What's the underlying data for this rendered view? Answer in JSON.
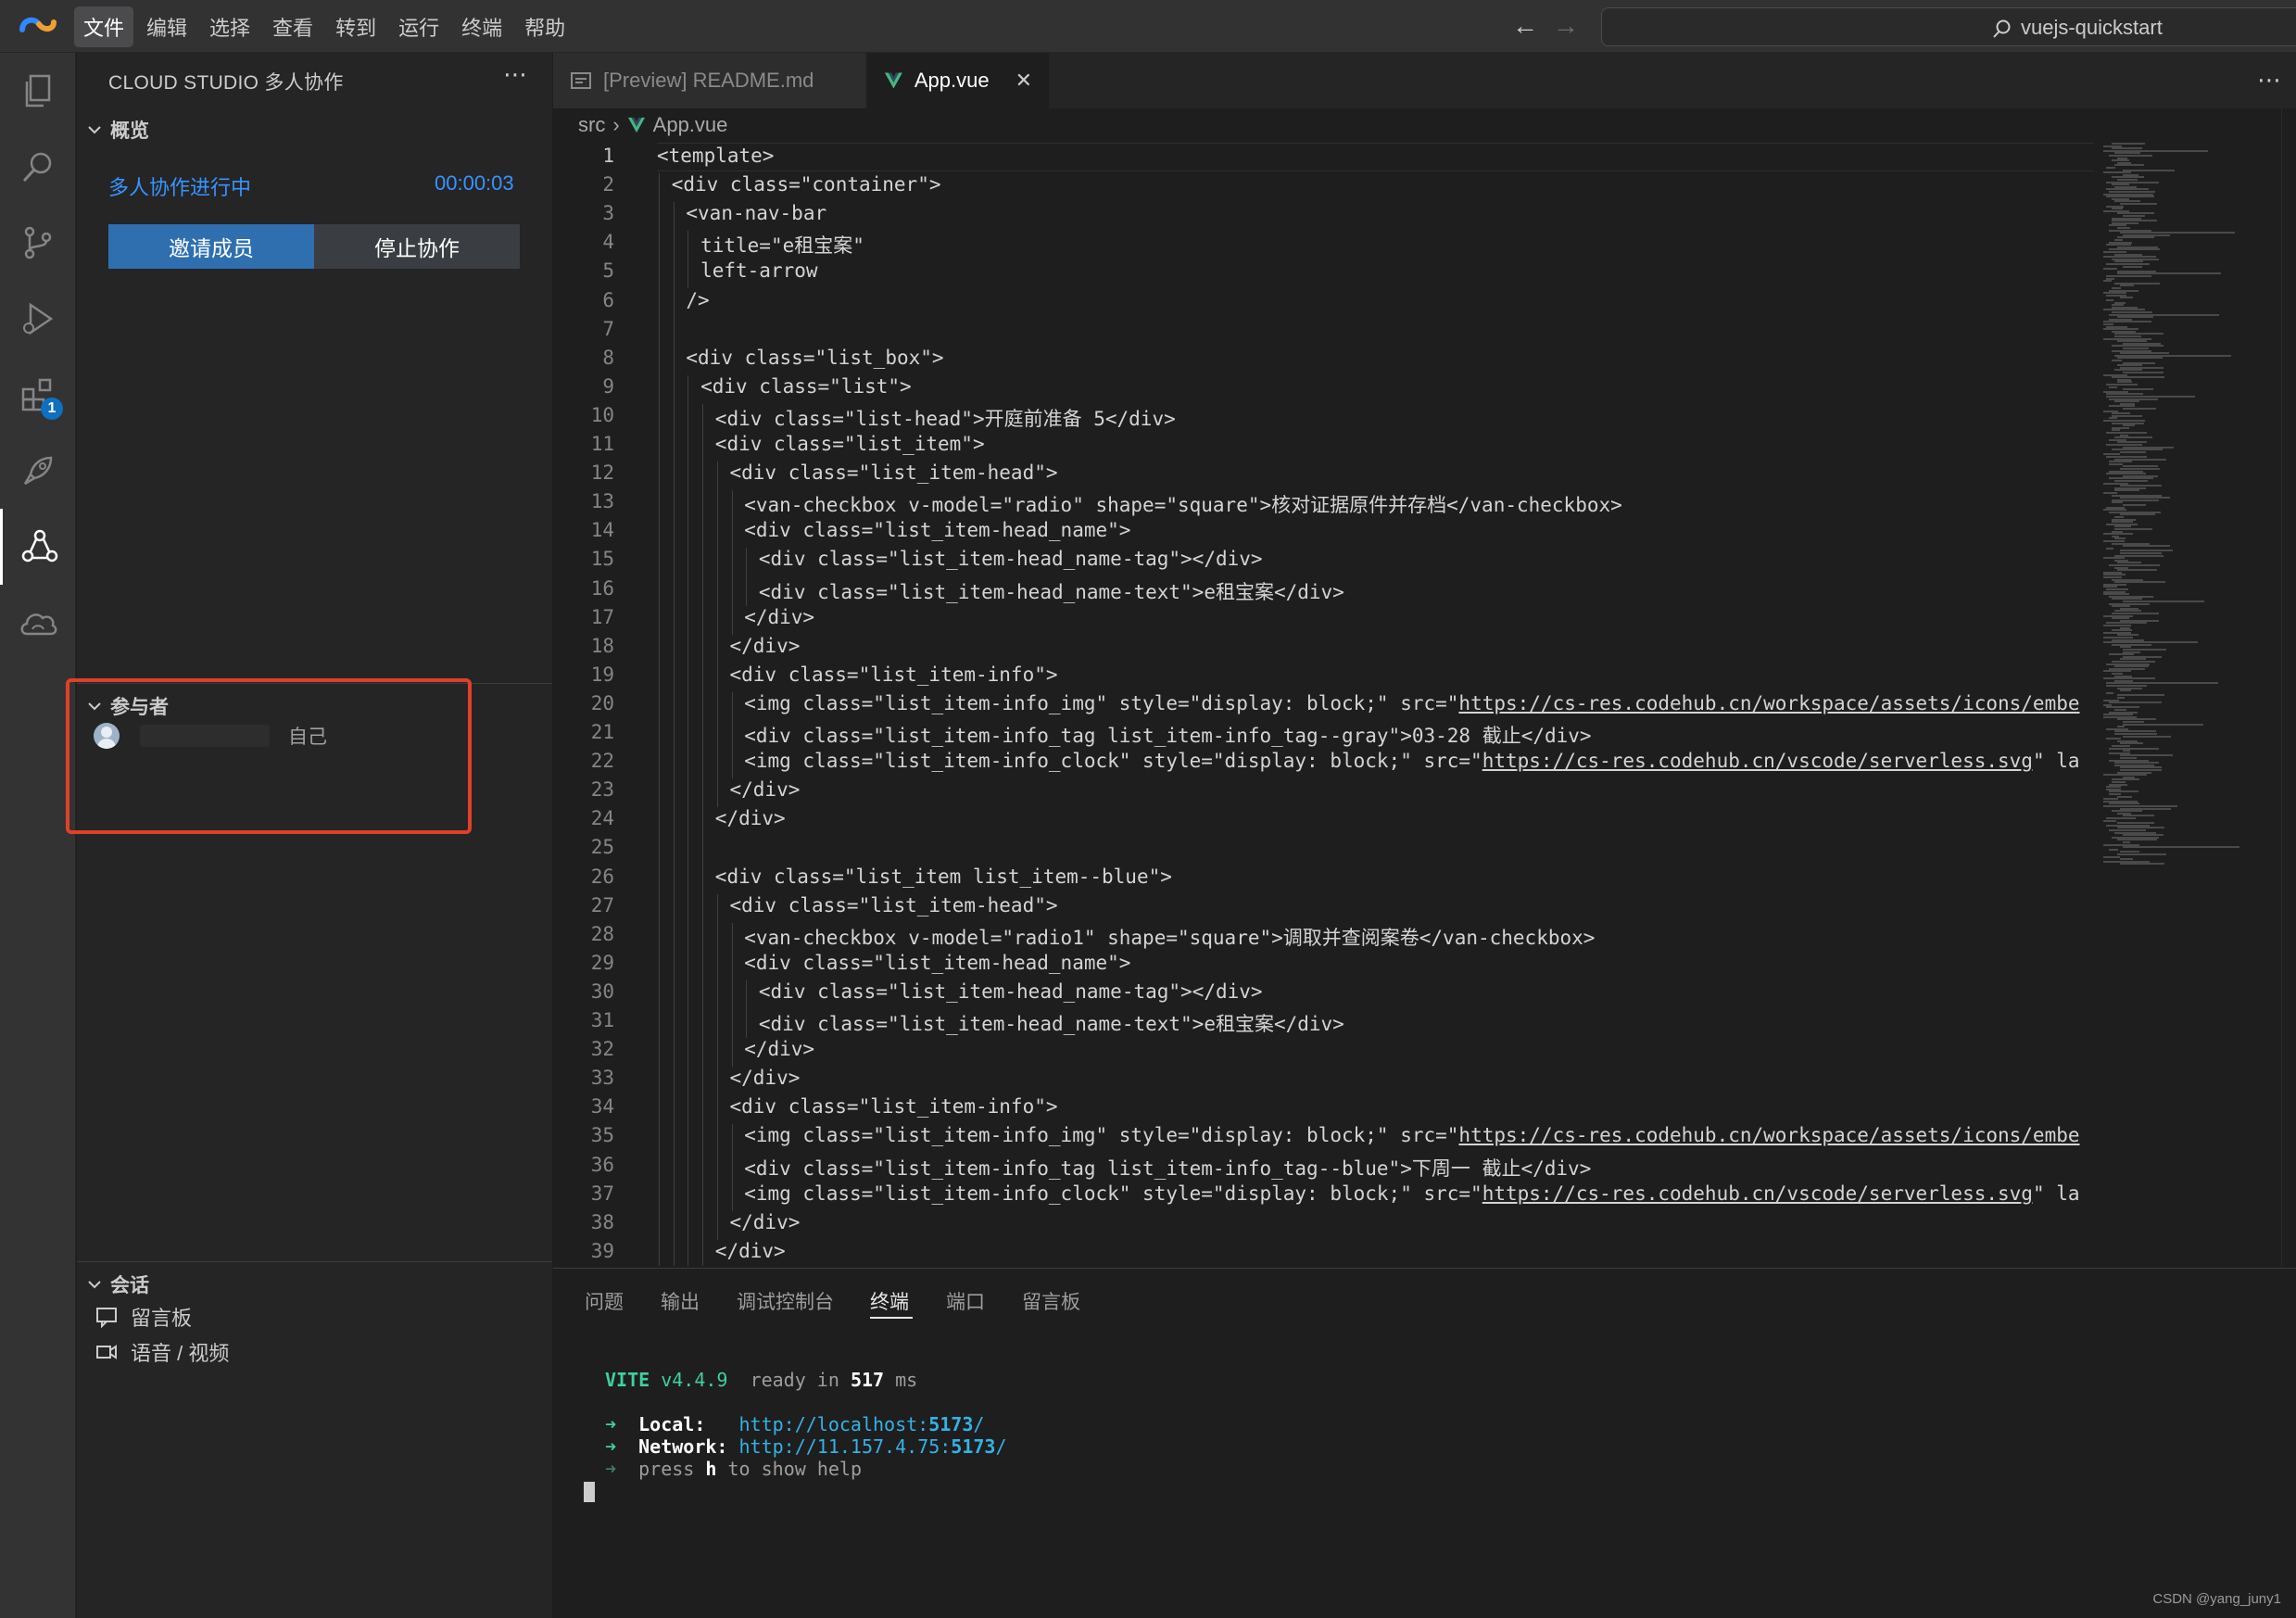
{
  "menu": {
    "items": [
      "文件",
      "编辑",
      "选择",
      "查看",
      "转到",
      "运行",
      "终端",
      "帮助"
    ],
    "active_index": 0
  },
  "search": {
    "text": "vuejs-quickstart"
  },
  "activity_bar": {
    "icons": [
      "explorer-icon",
      "search-icon",
      "source-control-icon",
      "run-debug-icon",
      "extensions-icon",
      "deploy-icon",
      "collaboration-icon",
      "cloud-icon"
    ],
    "extensions_badge": "1"
  },
  "sidebar": {
    "title": "CLOUD STUDIO 多人协作",
    "overview": {
      "heading": "概览",
      "status": "多人协作进行中",
      "timer": "00:00:03",
      "invite_label": "邀请成员",
      "stop_label": "停止协作"
    },
    "participants": {
      "heading": "参与者",
      "self_label": "自己"
    },
    "session": {
      "heading": "会话",
      "items": [
        "留言板",
        "语音 / 视频"
      ]
    }
  },
  "tabs": [
    {
      "label": "[Preview] README.md",
      "active": false
    },
    {
      "label": "App.vue",
      "active": true
    }
  ],
  "breadcrumb": [
    "src",
    "App.vue"
  ],
  "code": {
    "current_line": 1,
    "lines": [
      {
        "n": "1",
        "indent": 0,
        "text": "<template>"
      },
      {
        "n": "2",
        "indent": 1,
        "text": "<div class=\"container\">"
      },
      {
        "n": "3",
        "indent": 2,
        "text": "<van-nav-bar"
      },
      {
        "n": "4",
        "indent": 3,
        "text": "title=\"e租宝案\""
      },
      {
        "n": "5",
        "indent": 3,
        "text": "left-arrow"
      },
      {
        "n": "6",
        "indent": 2,
        "text": "/>"
      },
      {
        "n": "7",
        "indent": 0,
        "text": ""
      },
      {
        "n": "8",
        "indent": 2,
        "text": "<div class=\"list_box\">"
      },
      {
        "n": "9",
        "indent": 3,
        "text": "<div class=\"list\">"
      },
      {
        "n": "10",
        "indent": 4,
        "text": "<div class=\"list-head\">开庭前准备 5</div>"
      },
      {
        "n": "11",
        "indent": 4,
        "text": "<div class=\"list_item\">"
      },
      {
        "n": "12",
        "indent": 5,
        "text": "<div class=\"list_item-head\">"
      },
      {
        "n": "13",
        "indent": 6,
        "text": "<van-checkbox v-model=\"radio\" shape=\"square\">核对证据原件并存档</van-checkbox>"
      },
      {
        "n": "14",
        "indent": 6,
        "text": "<div class=\"list_item-head_name\">"
      },
      {
        "n": "15",
        "indent": 7,
        "text": "<div class=\"list_item-head_name-tag\"></div>"
      },
      {
        "n": "16",
        "indent": 7,
        "text": "<div class=\"list_item-head_name-text\">e租宝案</div>"
      },
      {
        "n": "17",
        "indent": 6,
        "text": "</div>"
      },
      {
        "n": "18",
        "indent": 5,
        "text": "</div>"
      },
      {
        "n": "19",
        "indent": 5,
        "text": "<div class=\"list_item-info\">"
      },
      {
        "n": "20",
        "indent": 6,
        "text": "<img class=\"list_item-info_img\" style=\"display: block;\" src=\"",
        "url": "https://cs-res.codehub.cn/workspace/assets/icons/embe"
      },
      {
        "n": "21",
        "indent": 6,
        "text": "<div class=\"list_item-info_tag list_item-info_tag--gray\">03-28 截止</div>"
      },
      {
        "n": "22",
        "indent": 6,
        "text": "<img class=\"list_item-info_clock\" style=\"display: block;\" src=\"",
        "url": "https://cs-res.codehub.cn/vscode/serverless.svg",
        "tail": "\" la"
      },
      {
        "n": "23",
        "indent": 5,
        "text": "</div>"
      },
      {
        "n": "24",
        "indent": 4,
        "text": "</div>"
      },
      {
        "n": "25",
        "indent": 0,
        "text": ""
      },
      {
        "n": "26",
        "indent": 4,
        "text": "<div class=\"list_item list_item--blue\">"
      },
      {
        "n": "27",
        "indent": 5,
        "text": "<div class=\"list_item-head\">"
      },
      {
        "n": "28",
        "indent": 6,
        "text": "<van-checkbox v-model=\"radio1\" shape=\"square\">调取并查阅案卷</van-checkbox>"
      },
      {
        "n": "29",
        "indent": 6,
        "text": "<div class=\"list_item-head_name\">"
      },
      {
        "n": "30",
        "indent": 7,
        "text": "<div class=\"list_item-head_name-tag\"></div>"
      },
      {
        "n": "31",
        "indent": 7,
        "text": "<div class=\"list_item-head_name-text\">e租宝案</div>"
      },
      {
        "n": "32",
        "indent": 6,
        "text": "</div>"
      },
      {
        "n": "33",
        "indent": 5,
        "text": "</div>"
      },
      {
        "n": "34",
        "indent": 5,
        "text": "<div class=\"list_item-info\">"
      },
      {
        "n": "35",
        "indent": 6,
        "text": "<img class=\"list_item-info_img\" style=\"display: block;\" src=\"",
        "url": "https://cs-res.codehub.cn/workspace/assets/icons/embe"
      },
      {
        "n": "36",
        "indent": 6,
        "text": "<div class=\"list_item-info_tag list_item-info_tag--blue\">下周一 截止</div>"
      },
      {
        "n": "37",
        "indent": 6,
        "text": "<img class=\"list_item-info_clock\" style=\"display: block;\" src=\"",
        "url": "https://cs-res.codehub.cn/vscode/serverless.svg",
        "tail": "\" la"
      },
      {
        "n": "38",
        "indent": 5,
        "text": "</div>"
      },
      {
        "n": "39",
        "indent": 4,
        "text": "</div>"
      }
    ]
  },
  "panel": {
    "tabs": [
      "问题",
      "输出",
      "调试控制台",
      "终端",
      "端口",
      "留言板"
    ],
    "active_tab": "终端",
    "terminal": {
      "vite_name": "VITE",
      "vite_version": "v4.4.9",
      "ready_text": "ready in",
      "ready_ms": "517",
      "ms_unit": "ms",
      "arrow": "➜",
      "local_label": "Local:",
      "local_url_prefix": "http://localhost:",
      "local_port": "5173",
      "network_label": "Network:",
      "network_url_prefix": "http://11.157.4.75:",
      "network_port": "5173",
      "help_press": "press",
      "help_key": "h",
      "help_rest": "to show help"
    }
  },
  "watermark": "CSDN @yang_juny1",
  "colors": {
    "accent_blue": "#3794ff",
    "primary_button": "#2f6fb0",
    "highlight_red": "#e0402a",
    "vite_green": "#3fd0a0",
    "terminal_cyan": "#35b2e6"
  }
}
